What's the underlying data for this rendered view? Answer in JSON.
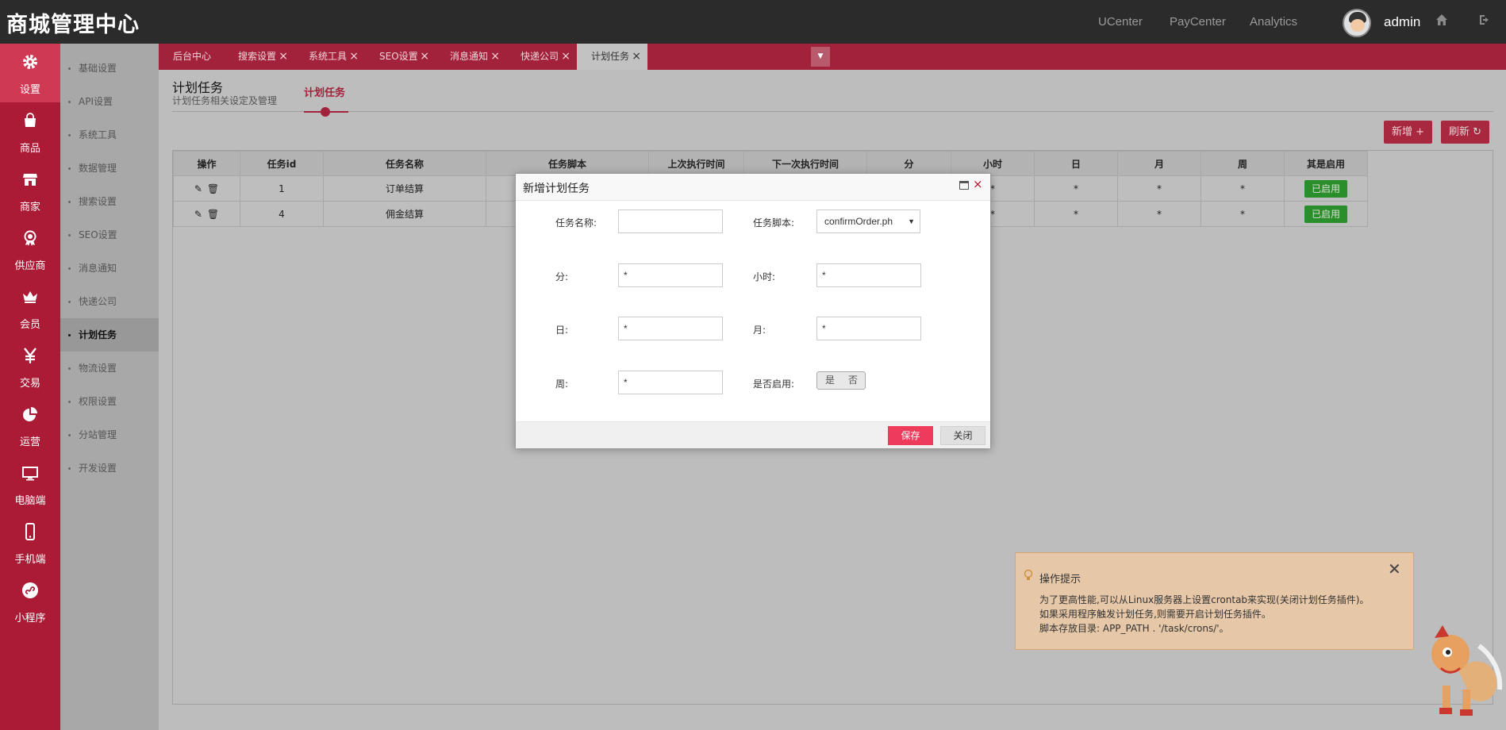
{
  "header": {
    "brand": "商城管理中心",
    "links": [
      "UCenter",
      "PayCenter",
      "Analytics"
    ],
    "username": "admin",
    "icons": [
      "home-icon",
      "logout-icon"
    ]
  },
  "sidebar": {
    "items": [
      {
        "label": "设置",
        "icon": "gear-icon"
      },
      {
        "label": "商品",
        "icon": "bag-icon"
      },
      {
        "label": "商家",
        "icon": "store-icon"
      },
      {
        "label": "供应商",
        "icon": "award-icon"
      },
      {
        "label": "会员",
        "icon": "crown-icon"
      },
      {
        "label": "交易",
        "icon": "yen-icon"
      },
      {
        "label": "运营",
        "icon": "pie-chart-icon"
      },
      {
        "label": "电脑端",
        "icon": "monitor-icon"
      },
      {
        "label": "手机端",
        "icon": "phone-icon"
      },
      {
        "label": "小程序",
        "icon": "miniprogram-icon"
      }
    ]
  },
  "subnav": {
    "items": [
      "基础设置",
      "API设置",
      "系统工具",
      "数据管理",
      "搜索设置",
      "SEO设置",
      "消息通知",
      "快递公司",
      "计划任务",
      "物流设置",
      "权限设置",
      "分站管理",
      "开发设置"
    ],
    "active": "计划任务"
  },
  "tabs": {
    "items": [
      {
        "label": "后台中心",
        "closable": false
      },
      {
        "label": "搜索设置",
        "closable": true
      },
      {
        "label": "系统工具",
        "closable": true
      },
      {
        "label": "SEO设置",
        "closable": true
      },
      {
        "label": "消息通知",
        "closable": true
      },
      {
        "label": "快递公司",
        "closable": true
      },
      {
        "label": "计划任务",
        "closable": true
      }
    ],
    "close_glyph": "×",
    "more_glyph": "▼",
    "active": "计划任务"
  },
  "page": {
    "title": "计划任务",
    "subtitle": "计划任务相关设定及管理",
    "subtab": "计划任务",
    "add_button": "新增 +",
    "refresh_button": "刷新 ↻"
  },
  "table": {
    "columns": [
      "操作",
      "任务id",
      "任务名称",
      "任务脚本",
      "上次执行时间",
      "下一次执行时间",
      "分",
      "小时",
      "日",
      "月",
      "周",
      "其是启用"
    ],
    "rows": [
      {
        "id": "1",
        "name": "订单结算",
        "hour": "*",
        "day": "*",
        "month": "*",
        "week": "*",
        "status": "已启用"
      },
      {
        "id": "4",
        "name": "佣金结算",
        "hour": "*",
        "day": "*",
        "month": "*",
        "week": "*",
        "status": "已启用"
      }
    ],
    "edit_glyph": "✎",
    "delete_glyph": "🗑"
  },
  "modal": {
    "title": "新增计划任务",
    "close_glyph": "×",
    "fields": {
      "name_label": "任务名称:",
      "name_value": "",
      "script_label": "任务脚本:",
      "script_value": "confirmOrder.ph",
      "minute_label": "分:",
      "minute_value": "*",
      "hour_label": "小时:",
      "hour_value": "*",
      "day_label": "日:",
      "day_value": "*",
      "month_label": "月:",
      "month_value": "*",
      "week_label": "周:",
      "week_value": "*",
      "enabled_label": "是否启用:",
      "enabled_yes": "是",
      "enabled_no": "否"
    },
    "save_button": "保存",
    "close_button": "关闭"
  },
  "tips": {
    "title": "操作提示",
    "lines": [
      "为了更高性能,可以从Linux服务器上设置crontab来实现(关闭计划任务插件)。",
      "如果采用程序触发计划任务,则需要开启计划任务插件。",
      "脚本存放目录: APP_PATH . '/task/crons/'。"
    ],
    "close_glyph": "✕"
  },
  "colors": {
    "accent": "#a3223b",
    "sidebar": "#ab1b36",
    "topbar": "#2b2b2b",
    "enabled_green": "#2a8e2a",
    "save_pink": "#ee3b5c"
  }
}
